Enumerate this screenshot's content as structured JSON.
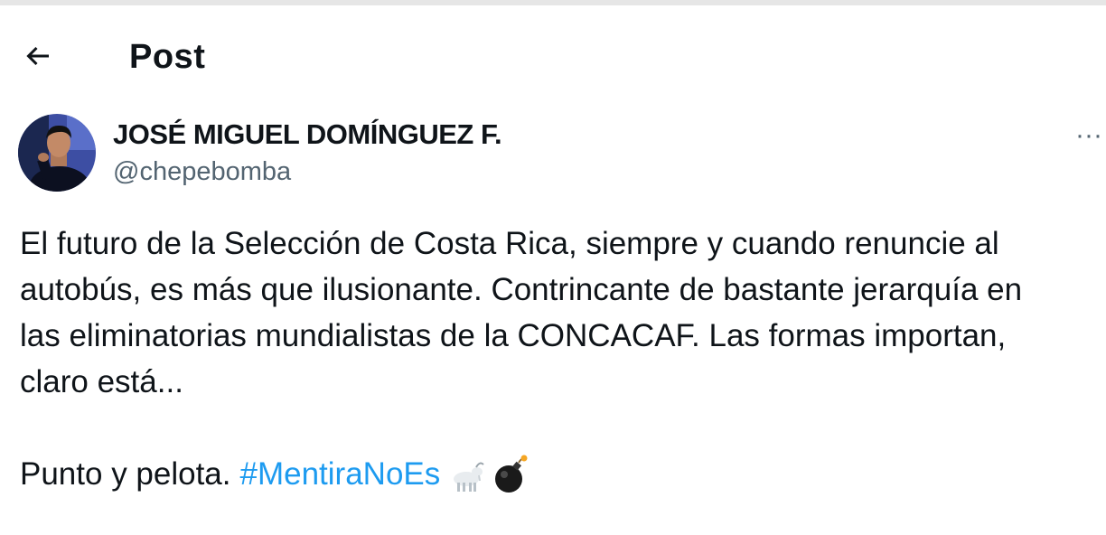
{
  "header": {
    "title": "Post",
    "back_icon": "arrow-left-icon"
  },
  "author": {
    "display_name": "JOSÉ MIGUEL DOMÍNGUEZ F.",
    "handle": "@chepebomba",
    "avatar_icon": "profile-photo",
    "more_label": "···"
  },
  "post": {
    "lines": [
      "El futuro de la Selección de Costa Rica, siempre y cuando renuncie al",
      "autobús, es más que ilusionante. Contrincante de bastante jerarquía en",
      "las eliminatorias mundialistas de la CONCACAF. Las formas importan,",
      "claro está..."
    ],
    "closing_text": "Punto y pelota.",
    "hashtag": "#MentiraNoEs",
    "emojis": [
      "goat-emoji",
      "bomb-emoji"
    ]
  },
  "colors": {
    "text": "#0f1419",
    "secondary": "#536471",
    "link": "#1d9bf0",
    "background": "#ffffff"
  }
}
